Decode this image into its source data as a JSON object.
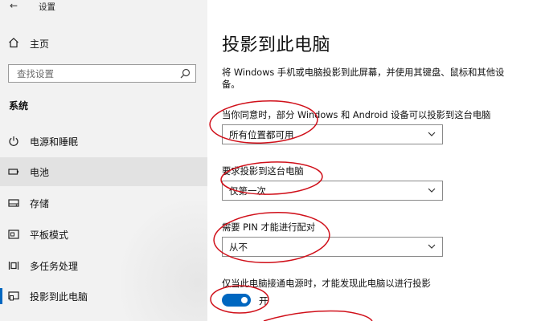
{
  "titlebar": {
    "back_glyph": "←",
    "title": "设置"
  },
  "sidebar": {
    "home_label": "主页",
    "search_placeholder": "查找设置",
    "section_title": "系统",
    "items": [
      {
        "label": "电源和睡眠",
        "icon": "power-icon"
      },
      {
        "label": "电池",
        "icon": "battery-icon"
      },
      {
        "label": "存储",
        "icon": "storage-icon"
      },
      {
        "label": "平板模式",
        "icon": "tablet-mode-icon"
      },
      {
        "label": "多任务处理",
        "icon": "multitasking-icon"
      },
      {
        "label": "投影到此电脑",
        "icon": "project-icon"
      }
    ]
  },
  "main": {
    "title": "投影到此电脑",
    "description": "将 Windows 手机或电脑投影到此屏幕，并使用其键盘、鼠标和其他设备。",
    "settings": [
      {
        "label": "当你同意时，部分 Windows 和 Android 设备可以投影到这台电脑",
        "value": "所有位置都可用"
      },
      {
        "label": "要求投影到这台电脑",
        "value": "仅第一次"
      },
      {
        "label": "需要 PIN 才能进行配对",
        "value": "从不"
      }
    ],
    "power_label": "仅当此电脑接通电源时，才能发现此电脑以进行投影",
    "toggle_state": "开",
    "toggle_on": true
  },
  "colors": {
    "accent": "#0067c0",
    "annotation": "#d0101a",
    "sidebar_bg": "#f2f2f2"
  }
}
